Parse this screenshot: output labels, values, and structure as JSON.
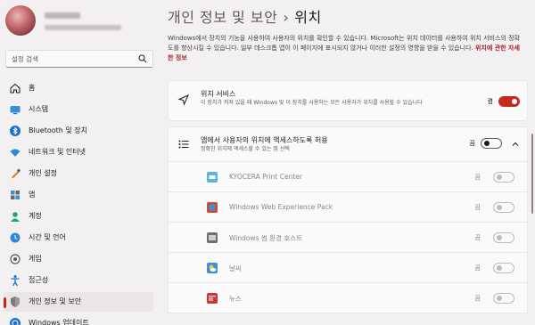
{
  "sidebar": {
    "search_placeholder": "설정 검색",
    "items": [
      {
        "label": "홈",
        "icon": "home-icon"
      },
      {
        "label": "시스템",
        "icon": "system-icon"
      },
      {
        "label": "Bluetooth 및 장치",
        "icon": "bluetooth-icon"
      },
      {
        "label": "네트워크 및 인터넷",
        "icon": "network-icon"
      },
      {
        "label": "개인 설정",
        "icon": "personalization-icon"
      },
      {
        "label": "앱",
        "icon": "apps-icon"
      },
      {
        "label": "계정",
        "icon": "accounts-icon"
      },
      {
        "label": "시간 및 언어",
        "icon": "time-language-icon"
      },
      {
        "label": "게임",
        "icon": "gaming-icon"
      },
      {
        "label": "접근성",
        "icon": "accessibility-icon"
      },
      {
        "label": "개인 정보 및 보안",
        "icon": "privacy-shield-icon",
        "active": true
      },
      {
        "label": "Windows 업데이트",
        "icon": "windows-update-icon"
      }
    ]
  },
  "header": {
    "parent": "개인 정보 및 보안",
    "separator": "›",
    "current": "위치"
  },
  "description": {
    "text": "Windows에서 장치의 기능을 사용하여 사용자의 위치를 확인할 수 있습니다. Microsoft는 위치 데이터를 사용하여 위치 서비스의 정확도를 향상시킬 수 있습니다. 일부 데스크톱 앱이 이 페이지에 표시되지 않거나 이러한 설정의 영향을 받을 수 있습니다.",
    "link": "위치에 관한 자세한 정보"
  },
  "location_services": {
    "title": "위치 서비스",
    "subtitle": "이 장치가 켜져 있을 때 Windows 및 이 장치를 사용하는 모든 사용자가 위치를 사용할 수 있습니다",
    "state": "켬",
    "on": true
  },
  "app_access": {
    "title": "앱에서 사용자의 위치에 액세스하도록 허용",
    "subtitle": "정확한 위치에 액세스할 수 있는 앱 선택",
    "state": "끔",
    "on": false
  },
  "apps": [
    {
      "name": "KYOCERA Print Center",
      "state": "끔"
    },
    {
      "name": "Windows Web Experience Pack",
      "state": "끔"
    },
    {
      "name": "Windows 썸 환경 호스트",
      "state": "끔"
    },
    {
      "name": "날씨",
      "state": "끔"
    },
    {
      "name": "뉴스",
      "state": "끔"
    }
  ],
  "colors": {
    "accent": "#c42b1c",
    "link": "#a4262c"
  }
}
